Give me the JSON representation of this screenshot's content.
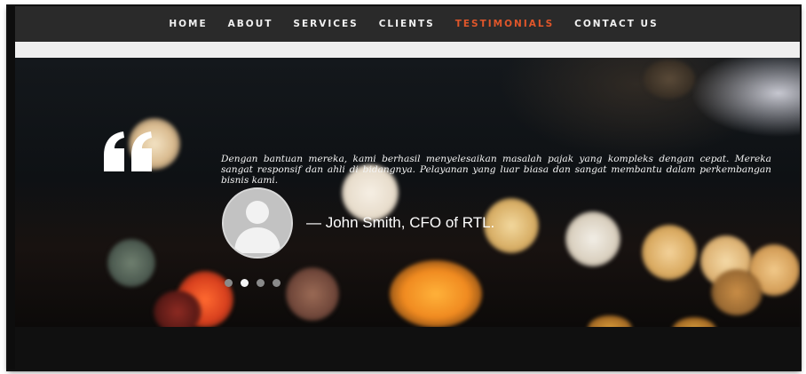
{
  "nav": {
    "items": [
      {
        "label": "HOME",
        "active": false
      },
      {
        "label": "ABOUT",
        "active": false
      },
      {
        "label": "SERVICES",
        "active": false
      },
      {
        "label": "CLIENTS",
        "active": false
      },
      {
        "label": "TESTIMONIALS",
        "active": true
      },
      {
        "label": "CONTACT US",
        "active": false
      }
    ],
    "active_color": "#e0562a"
  },
  "testimonial": {
    "quote_icon": "quote-open-icon",
    "text": "Dengan bantuan mereka, kami berhasil menyelesaikan masalah pajak yang kompleks dengan cepat. Mereka sangat responsif dan ahli di bidangnya. Pelayanan yang luar biasa dan sangat membantu dalam perkembangan bisnis kami.",
    "author": "— John Smith, CFO of RTL.",
    "avatar_icon": "user-silhouette-icon"
  },
  "carousel": {
    "slide_count": 4,
    "active_index": 1
  }
}
